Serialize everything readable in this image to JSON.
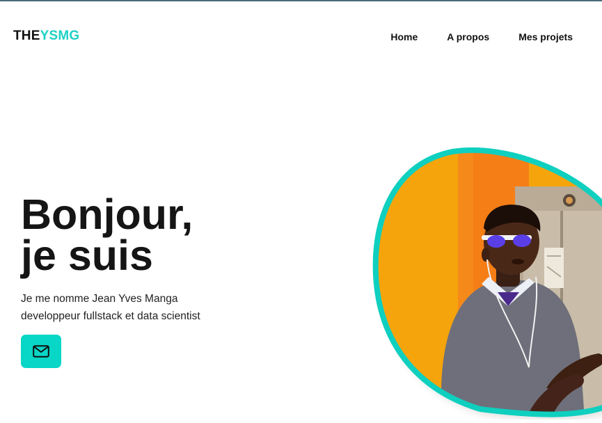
{
  "brand": {
    "logo_part1": "THE",
    "logo_part2": "YSMG",
    "accent_color": "#1fd1c4"
  },
  "nav": {
    "items": [
      {
        "label": "Home"
      },
      {
        "label": "A propos"
      },
      {
        "label": "Mes projets"
      }
    ]
  },
  "hero": {
    "greeting_line1": "Bonjour,",
    "greeting_line2": "je suis",
    "intro_line1": "Je me nomme Jean Yves Manga",
    "intro_line2": "developpeur fullstack et data scientist",
    "contact_button_icon": "mail-icon",
    "contact_button_color": "#08d6c6",
    "portrait_border_color": "#0fcfbf"
  }
}
